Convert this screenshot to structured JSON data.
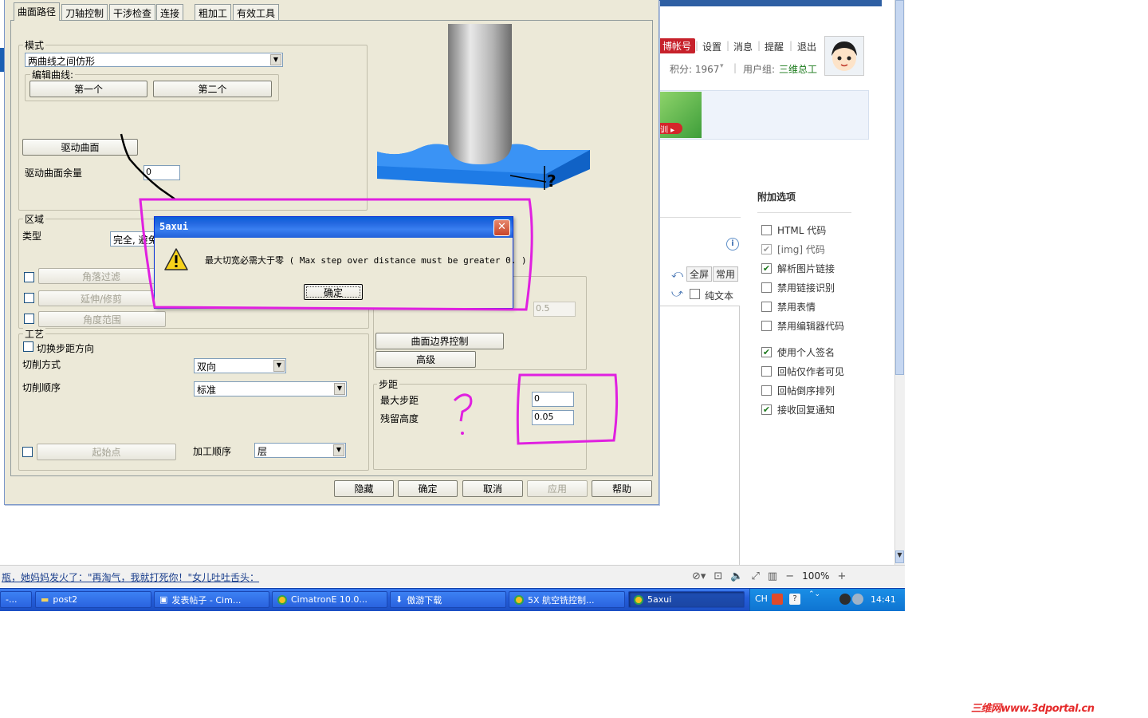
{
  "forum": {
    "user_links": [
      "设置",
      "消息",
      "提醒",
      "退出"
    ],
    "account_button": "博帐号",
    "points_label": "积分: 1967",
    "usergroup_label": "用户组:",
    "usergroup_value": "三维总工",
    "banner_badge": "训",
    "options_title": "附加选项",
    "options": [
      {
        "label": "HTML 代码",
        "checked": false,
        "disabled": false
      },
      {
        "label": "[img] 代码",
        "checked": true,
        "disabled": true
      },
      {
        "label": "解析图片链接",
        "checked": true,
        "disabled": false
      },
      {
        "label": "禁用链接识别",
        "checked": false,
        "disabled": false
      },
      {
        "label": "禁用表情",
        "checked": false,
        "disabled": false
      },
      {
        "label": "禁用编辑器代码",
        "checked": false,
        "disabled": false
      },
      {
        "label": "使用个人签名",
        "checked": true,
        "disabled": false
      },
      {
        "label": "回帖仅作者可见",
        "checked": false,
        "disabled": false
      },
      {
        "label": "回帖倒序排列",
        "checked": false,
        "disabled": false
      },
      {
        "label": "接收回复通知",
        "checked": true,
        "disabled": false
      }
    ],
    "editor": {
      "fullscreen": "全屏",
      "common": "常用",
      "plaintext": "纯文本"
    }
  },
  "browser": {
    "status_text": "瓶，她妈妈发火了：\"再淘气，我就打死你！\"女儿吐吐舌头：",
    "zoom": "100%"
  },
  "taskbar": {
    "tasks": [
      {
        "label": "-..."
      },
      {
        "label": "post2"
      },
      {
        "label": "发表帖子 - Cim..."
      },
      {
        "label": "CimatronE 10.0..."
      },
      {
        "label": "傲游下载"
      },
      {
        "label": "5X 航空铣控制..."
      },
      {
        "label": "5axui"
      }
    ],
    "lang": "CH",
    "clock": "14:41"
  },
  "watermark": "三维网www.3dportal.cn",
  "cad": {
    "tabs": [
      "曲面路径",
      "刀轴控制",
      "干涉检查",
      "连接",
      "粗加工",
      "有效工具"
    ],
    "mode_group": "模式",
    "mode_value": "两曲线之间仿形",
    "edit_curves_group": "编辑曲线:",
    "first_button": "第一个",
    "second_button": "第二个",
    "drive_surface_button": "驱动曲面",
    "drive_surface_allowance_label": "驱动曲面余量",
    "drive_surface_allowance_value": "0",
    "region_group": "区域",
    "type_label": "类型",
    "type_value": "完全, 避免",
    "corner_filter_button": "角落过滤",
    "extend_trim_button": "延伸/修剪",
    "angle_range_button": "角度范围",
    "process_group": "工艺",
    "switch_step_label": "切换步距方向",
    "cut_method_label": "切削方式",
    "cut_method_value": "双向",
    "cut_order_label": "切削顺序",
    "cut_order_value": "标准",
    "start_point_button": "起始点",
    "machining_order_label": "加工顺序",
    "machining_order_value": "层",
    "disabled_field_value": "0.5",
    "surface_edge_button": "曲面边界控制",
    "advanced_button": "高级",
    "stepover_group": "步距",
    "max_stepover_label": "最大步距",
    "max_stepover_value": "0",
    "scallop_height_label": "残留高度",
    "scallop_height_value": "0.05",
    "buttons": {
      "hide": "隐藏",
      "ok": "确定",
      "cancel": "取消",
      "apply": "应用",
      "help": "帮助"
    }
  },
  "message_box": {
    "title": "5axui",
    "text": "最大切宽必需大于零 ( Max step over distance must be greater 0. )",
    "ok": "确定"
  },
  "colors": {
    "annotation": "#e020e0",
    "title_bar": "#2468e0",
    "tool_blue": "#1e7be6"
  }
}
